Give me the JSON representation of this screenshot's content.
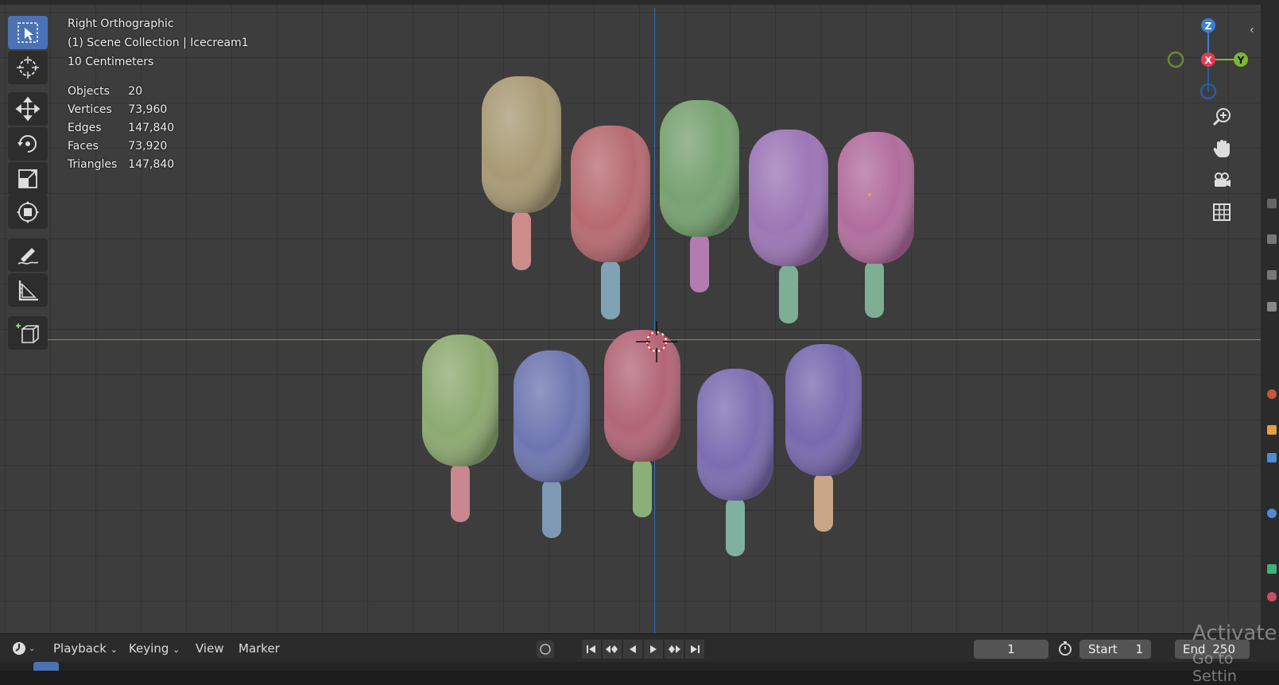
{
  "viewport": {
    "view_name": "Right Orthographic",
    "collection_prefix": "(1) Scene Collection",
    "active_object": "Icecream1",
    "scale_label": "10 Centimeters",
    "stats": [
      {
        "label": "Objects",
        "value": "20"
      },
      {
        "label": "Vertices",
        "value": "73,960"
      },
      {
        "label": "Edges",
        "value": "147,840"
      },
      {
        "label": "Faces",
        "value": "73,920"
      },
      {
        "label": "Triangles",
        "value": "147,840"
      }
    ],
    "background_color": "#3d3d3d",
    "axis_colors": {
      "x_line": "#7a9a3a",
      "y_line": "#2f6fb5"
    }
  },
  "toolbar": {
    "tools": [
      {
        "name": "select-box",
        "icon": "select-cursor-icon",
        "active": true
      },
      {
        "name": "cursor",
        "icon": "3d-cursor-icon"
      },
      {
        "name": "move",
        "icon": "move-arrows-icon"
      },
      {
        "name": "rotate",
        "icon": "rotate-icon"
      },
      {
        "name": "scale",
        "icon": "scale-icon"
      },
      {
        "name": "transform",
        "icon": "transform-icon"
      },
      {
        "name": "annotate",
        "icon": "annotate-pen-icon"
      },
      {
        "name": "measure",
        "icon": "ruler-icon"
      },
      {
        "name": "add-cube",
        "icon": "add-cube-icon"
      }
    ],
    "active_color": "#4a72b5"
  },
  "gizmo": {
    "z_label": "Z",
    "x_label": "X",
    "y_label": "Y",
    "colors": {
      "x": "#e63a4e",
      "y": "#7cb82f",
      "z": "#3a7fd5"
    }
  },
  "nav_buttons": [
    {
      "icon": "zoom-icon"
    },
    {
      "icon": "hand-pan-icon"
    },
    {
      "icon": "camera-icon"
    },
    {
      "icon": "grid-ortho-icon"
    }
  ],
  "popsicles": [
    {
      "body": "#a89a74",
      "stick": "#cc8d8a"
    },
    {
      "body": "#b66a70",
      "stick": "#7fa3b3"
    },
    {
      "body": "#77a271",
      "stick": "#b27cb1"
    },
    {
      "body": "#9c76b5",
      "stick": "#7fae96"
    },
    {
      "body": "#b16d9e",
      "stick": "#7fae96"
    },
    {
      "body": "#8daa71",
      "stick": "#c88791"
    },
    {
      "body": "#6d76b0",
      "stick": "#7f98b3"
    },
    {
      "body": "#b26577",
      "stick": "#8ab078"
    },
    {
      "body": "#7b6db1",
      "stick": "#7fb0a0"
    },
    {
      "body": "#7669ae",
      "stick": "#c9a687"
    }
  ],
  "timeline": {
    "editor_icon": "clock-dial-icon",
    "menus": [
      "Playback",
      "Keying",
      "View",
      "Marker"
    ],
    "current_frame": "1",
    "start_label": "Start",
    "start_value": "1",
    "end_label": "End",
    "end_value": "250"
  },
  "watermark": {
    "line1": "Activate",
    "line2": "Go to Settin"
  }
}
